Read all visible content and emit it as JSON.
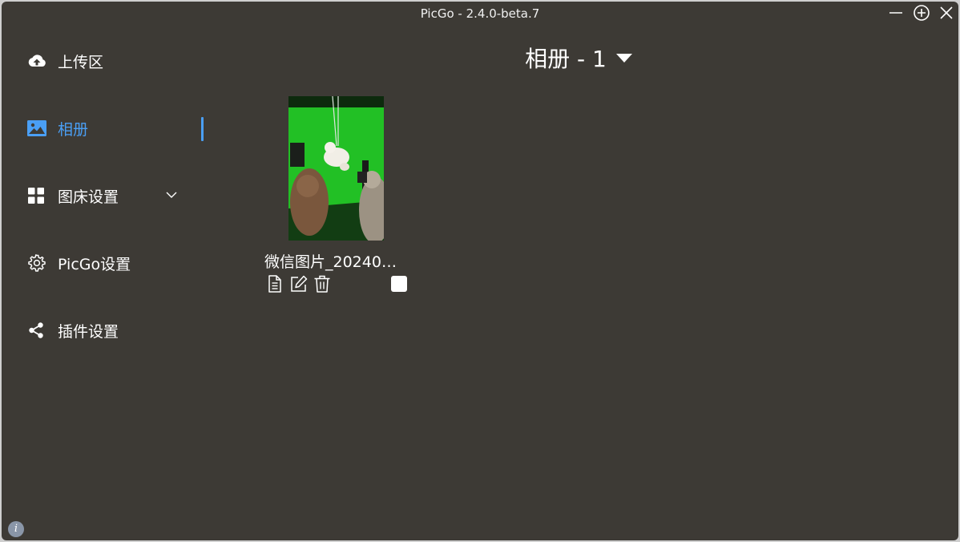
{
  "window": {
    "title": "PicGo - 2.4.0-beta.7"
  },
  "controls": {
    "minimize_icon": "minimize-icon",
    "maximize_icon": "plus-circle-icon",
    "close_icon": "close-icon"
  },
  "sidebar": {
    "items": [
      {
        "label": "上传区",
        "icon": "cloud-upload-icon"
      },
      {
        "label": "相册",
        "icon": "image-icon",
        "active": true
      },
      {
        "label": "图床设置",
        "icon": "grid-icon",
        "expandable": true
      },
      {
        "label": "PicGo设置",
        "icon": "gear-icon"
      },
      {
        "label": "插件设置",
        "icon": "share-icon"
      }
    ]
  },
  "gallery": {
    "title": "相册 - 1",
    "items": [
      {
        "filename": "微信图片_20240…"
      }
    ]
  },
  "colors": {
    "background": "#3d3a35",
    "accent": "#4a9ff5",
    "text": "#ffffff"
  }
}
